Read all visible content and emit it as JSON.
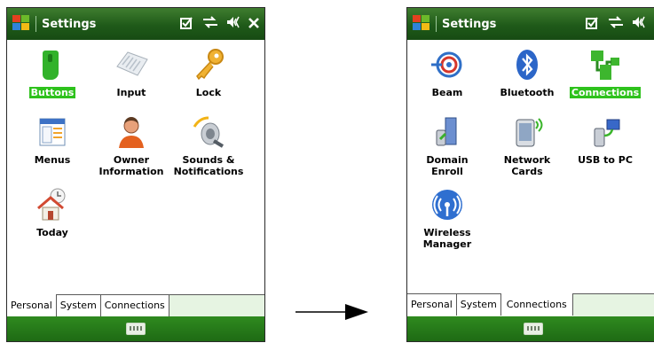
{
  "left": {
    "title": "Settings",
    "items": [
      {
        "label": "Buttons",
        "icon": "buttons-icon",
        "selected": true
      },
      {
        "label": "Input",
        "icon": "keyboard-icon"
      },
      {
        "label": "Lock",
        "icon": "key-icon"
      },
      {
        "label": "Menus",
        "icon": "menus-icon"
      },
      {
        "label": "Owner\nInformation",
        "icon": "owner-icon"
      },
      {
        "label": "Sounds &\nNotifications",
        "icon": "speaker-icon"
      },
      {
        "label": "Today",
        "icon": "home-clock-icon"
      }
    ],
    "tabs": [
      "Personal",
      "System",
      "Connections"
    ],
    "active_tab": 0
  },
  "right": {
    "title": "Settings",
    "items": [
      {
        "label": "Beam",
        "icon": "beam-icon"
      },
      {
        "label": "Bluetooth",
        "icon": "bluetooth-icon"
      },
      {
        "label": "Connections",
        "icon": "connections-icon",
        "selected": true
      },
      {
        "label": "Domain\nEnroll",
        "icon": "domain-enroll-icon"
      },
      {
        "label": "Network\nCards",
        "icon": "network-cards-icon"
      },
      {
        "label": "USB to PC",
        "icon": "usb-to-pc-icon"
      },
      {
        "label": "Wireless\nManager",
        "icon": "wireless-icon"
      }
    ],
    "tabs": [
      "Personal",
      "System",
      "Connections"
    ],
    "active_tab": 2
  },
  "colors": {
    "title_bar": "#1f5a19",
    "selection": "#2ec21c",
    "tab_strip": "#e6f4e2"
  }
}
